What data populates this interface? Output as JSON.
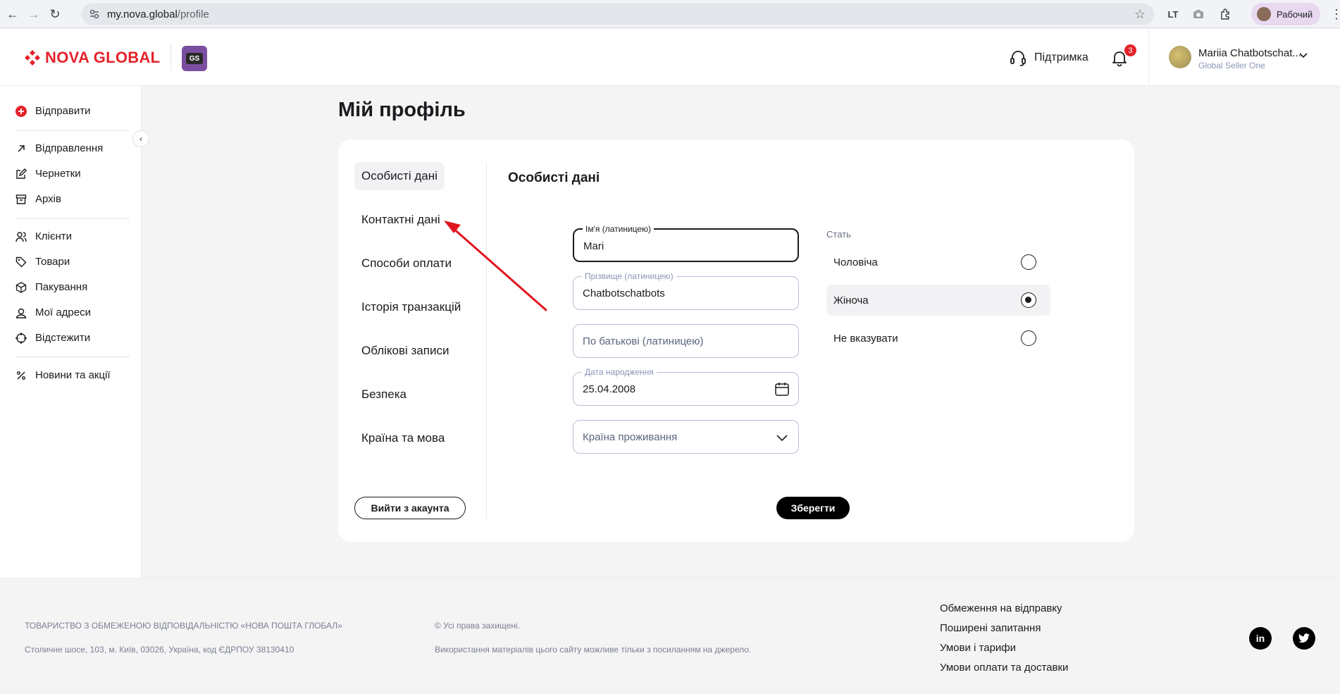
{
  "browser": {
    "url_domain": "my.nova.global",
    "url_path": "/profile",
    "profile_label": "Рабочий",
    "extension_label": "LT"
  },
  "header": {
    "logo_text": "NOVA GLOBAL",
    "badge_text": "GS",
    "support_label": "Підтримка",
    "notification_count": "3",
    "user_name": "Mariia Chatbotschat...",
    "user_company": "Global Seller One"
  },
  "sidebar": {
    "items": [
      {
        "label": "Відправити",
        "icon": "plus-circle-icon"
      },
      {
        "label": "Відправлення",
        "icon": "arrow-up-right-icon"
      },
      {
        "label": "Чернетки",
        "icon": "edit-icon"
      },
      {
        "label": "Архів",
        "icon": "archive-icon"
      },
      {
        "label": "Клієнти",
        "icon": "users-icon"
      },
      {
        "label": "Товари",
        "icon": "tag-icon"
      },
      {
        "label": "Пакування",
        "icon": "box-icon"
      },
      {
        "label": "Мої адреси",
        "icon": "user-pin-icon"
      },
      {
        "label": "Відстежити",
        "icon": "crosshair-icon"
      },
      {
        "label": "Новини та акції",
        "icon": "percent-icon"
      }
    ]
  },
  "page": {
    "title": "Мій профіль"
  },
  "profile": {
    "tabs": [
      {
        "label": "Особисті дані",
        "active": true
      },
      {
        "label": "Контактні дані",
        "active": false
      },
      {
        "label": "Способи оплати",
        "active": false
      },
      {
        "label": "Історія транзакцій",
        "active": false
      },
      {
        "label": "Облікові записи",
        "active": false
      },
      {
        "label": "Безпека",
        "active": false
      },
      {
        "label": "Країна та мова",
        "active": false
      }
    ],
    "logout_label": "Вийти з акаунта",
    "section_title": "Особисті дані",
    "fields": {
      "first_name": {
        "label": "Ім'я (латиницею)",
        "value": "Mari"
      },
      "last_name": {
        "label": "Прізвище (латиницею)",
        "value": "Chatbotschatbots"
      },
      "patronymic": {
        "placeholder": "По батькові (латиницею)"
      },
      "birth_date": {
        "label": "Дата народження",
        "value": "25.04.2008"
      },
      "country": {
        "placeholder": "Країна проживання"
      }
    },
    "gender": {
      "label": "Стать",
      "options": [
        {
          "label": "Чоловіча",
          "selected": false
        },
        {
          "label": "Жіноча",
          "selected": true
        },
        {
          "label": "Не вказувати",
          "selected": false
        }
      ]
    },
    "save_label": "Зберегти"
  },
  "annotation": {
    "color": "#e0141e"
  },
  "footer": {
    "company": "ТОВАРИСТВО З ОБМЕЖЕНОЮ ВІДПОВІДАЛЬНІСТЮ «НОВА ПОШТА ГЛОБАЛ»",
    "address": "Столичне шосе, 103, м. Київ, 03026, Україна, код ЄДРПОУ 38130410",
    "rights": "© Усі права захищені.",
    "usage": "Використання матеріалів цього сайту можливе тільки з посиланням на джерело.",
    "links": [
      "Обмеження на відправку",
      "Поширені запитання",
      "Умови і тарифи",
      "Умови оплати та доставки"
    ],
    "social": [
      {
        "label": "in",
        "icon": "linkedin-icon"
      },
      {
        "label": "twitter",
        "icon": "twitter-icon"
      }
    ]
  },
  "colors": {
    "brand": "#e5222b",
    "badge": "#7b4fa0",
    "accent_text": "#8a93b5"
  }
}
